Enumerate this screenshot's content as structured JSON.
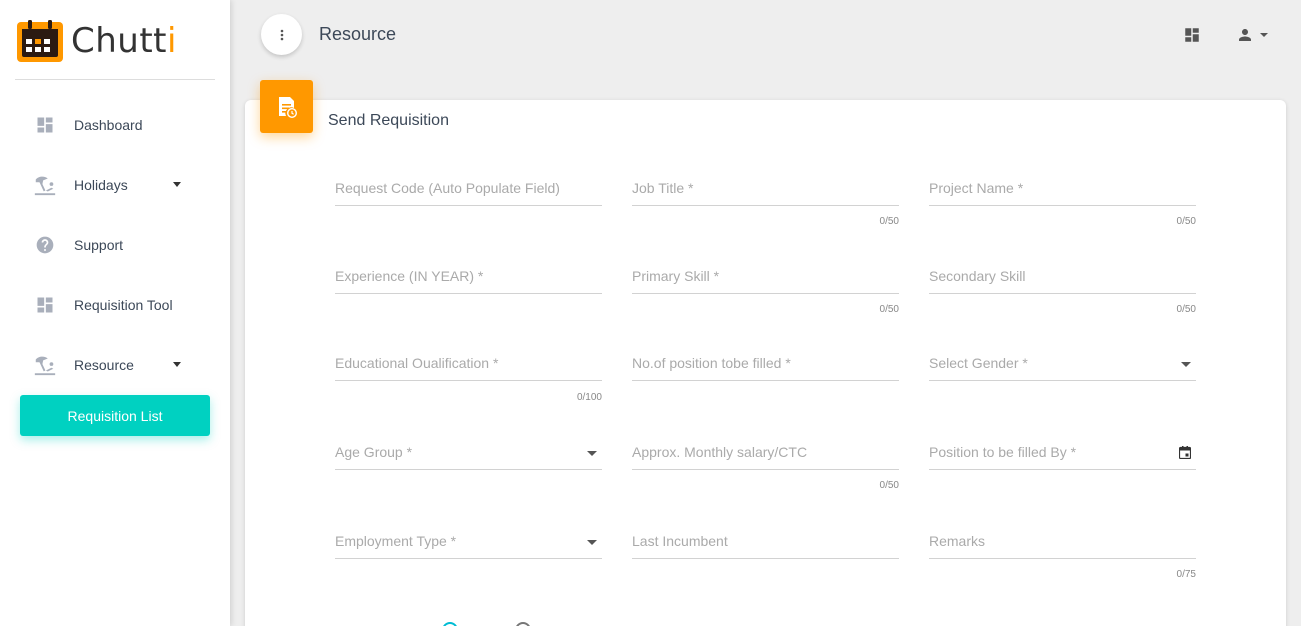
{
  "app": {
    "logo_prefix": "Chutt",
    "logo_accent": "i",
    "accent_color": "#ff9800",
    "active_color": "#00d1c1"
  },
  "sidebar": {
    "items": [
      {
        "label": "Dashboard",
        "icon": "dashboard-icon"
      },
      {
        "label": "Holidays",
        "icon": "beach-icon",
        "has_caret": true
      },
      {
        "label": "Support",
        "icon": "help-icon"
      },
      {
        "label": "Requisition Tool",
        "icon": "dashboard-icon"
      },
      {
        "label": "Resource",
        "icon": "beach-icon",
        "has_caret": true
      }
    ],
    "sub_active": "Requisition List"
  },
  "header": {
    "title": "Resource",
    "menu_icon": "more-vert-icon",
    "grid_icon": "dashboard-icon",
    "user_icon": "person-icon"
  },
  "card": {
    "title": "Send Requisition",
    "icon": "document-clock-icon"
  },
  "form": {
    "request_code": {
      "placeholder": "Request Code (Auto Populate Field)"
    },
    "job_title": {
      "placeholder": "Job Title *",
      "counter": "0/50"
    },
    "project_name": {
      "placeholder": "Project Name *",
      "counter": "0/50"
    },
    "experience": {
      "placeholder": "Experience (IN YEAR) *"
    },
    "primary_skill": {
      "placeholder": "Primary Skill *",
      "counter": "0/50"
    },
    "secondary_skill": {
      "placeholder": "Secondary Skill",
      "counter": "0/50"
    },
    "education": {
      "placeholder": "Educational Oualification *",
      "counter": "0/100"
    },
    "positions": {
      "placeholder": "No.of position tobe filled *"
    },
    "gender": {
      "placeholder": "Select Gender *"
    },
    "age_group": {
      "placeholder": "Age Group *"
    },
    "salary": {
      "placeholder": "Approx. Monthly salary/CTC",
      "counter": "0/50"
    },
    "fill_by": {
      "placeholder": "Position to be filled By *"
    },
    "employment_type": {
      "placeholder": "Employment Type *"
    },
    "last_incumbent": {
      "placeholder": "Last Incumbent"
    },
    "remarks": {
      "placeholder": "Remarks",
      "counter": "0/75"
    }
  }
}
